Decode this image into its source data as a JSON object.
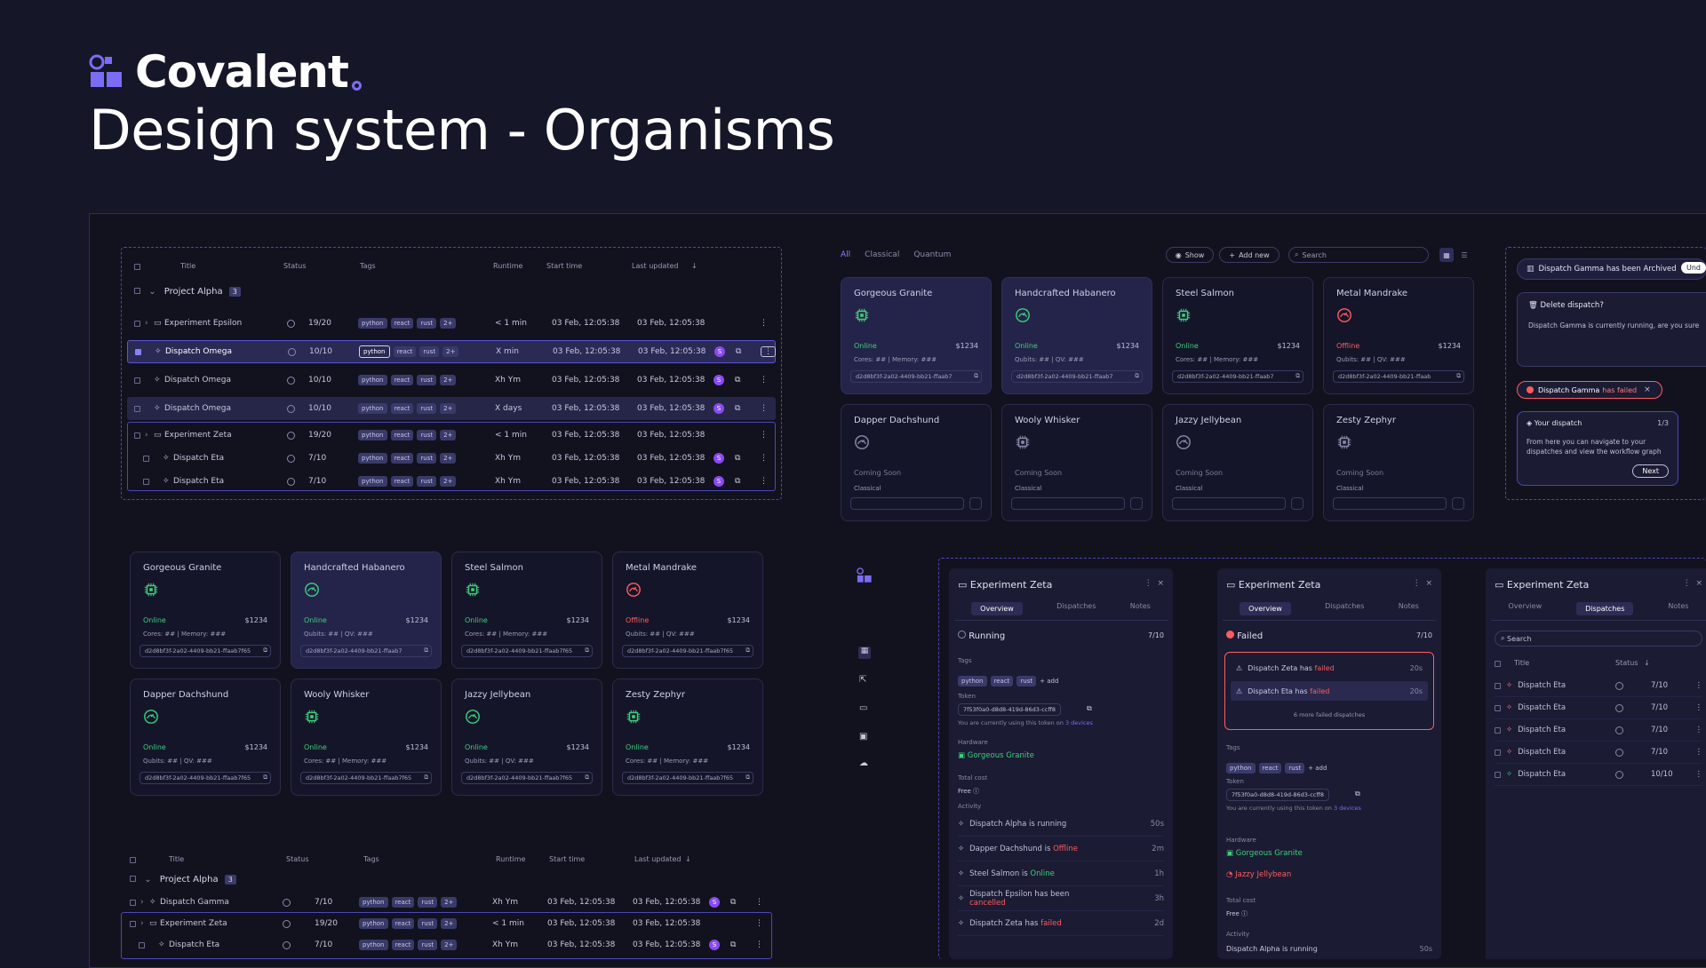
{
  "brand": "Covalent",
  "page_title": "Design system - Organisms",
  "table": {
    "headers": {
      "title": "Title",
      "status": "Status",
      "tags": "Tags",
      "runtime": "Runtime",
      "start": "Start time",
      "updated": "Last updated"
    },
    "group": {
      "name": "Project Alpha",
      "count": "3"
    },
    "rows": [
      {
        "name": "Experiment Epsilon",
        "status": "19/20",
        "runtime": "< 1 min",
        "start": "03 Feb, 12:05:38",
        "updated": "03 Feb, 12:05:38"
      },
      {
        "name": "Dispatch Omega",
        "status": "10/10",
        "runtime": "X min",
        "start": "03 Feb, 12:05:38",
        "updated": "03 Feb, 12:05:38"
      },
      {
        "name": "Dispatch Omega",
        "status": "10/10",
        "runtime": "Xh Ym",
        "start": "03 Feb, 12:05:38",
        "updated": "03 Feb, 12:05:38"
      },
      {
        "name": "Dispatch Omega",
        "status": "10/10",
        "runtime": "X days",
        "start": "03 Feb, 12:05:38",
        "updated": "03 Feb, 12:05:38"
      },
      {
        "name": "Experiment Zeta",
        "status": "19/20",
        "runtime": "< 1 min",
        "start": "03 Feb, 12:05:38",
        "updated": "03 Feb, 12:05:38"
      },
      {
        "name": "Dispatch Eta",
        "status": "7/10",
        "runtime": "Xh Ym",
        "start": "03 Feb, 12:05:38",
        "updated": "03 Feb, 12:05:38"
      },
      {
        "name": "Dispatch Eta",
        "status": "7/10",
        "runtime": "Xh Ym",
        "start": "03 Feb, 12:05:38",
        "updated": "03 Feb, 12:05:38"
      }
    ],
    "tags": [
      "python",
      "react",
      "rust",
      "2+"
    ],
    "avatar": "S"
  },
  "table2": {
    "rows": [
      {
        "name": "Dispatch Gamma",
        "status": "7/10",
        "runtime": "Xh Ym",
        "start": "03 Feb, 12:05:38",
        "updated": "03 Feb, 12:05:38"
      },
      {
        "name": "Experiment Zeta",
        "status": "19/20",
        "runtime": "< 1 min",
        "start": "03 Feb, 12:05:38",
        "updated": "03 Feb, 12:05:38"
      },
      {
        "name": "Dispatch Eta",
        "status": "7/10",
        "runtime": "Xh Ym",
        "start": "03 Feb, 12:05:38",
        "updated": "03 Feb, 12:05:38"
      }
    ]
  },
  "filters": {
    "all": "All",
    "classical": "Classical",
    "quantum": "Quantum",
    "show": "Show",
    "add_new": "Add new",
    "search": "Search"
  },
  "cards_top": [
    {
      "name": "Gorgeous Granite",
      "status": "Online",
      "price": "$1234",
      "meta": "Cores: ##  |  Memory: ###",
      "token": "d2d8bf3f-2a02-4409-bb21-ffaab7"
    },
    {
      "name": "Handcrafted Habanero",
      "status": "Online",
      "price": "$1234",
      "meta": "Qubits: ##  |  QV: ###",
      "token": "d2d8bf3f-2a02-4409-bb21-ffaab7"
    },
    {
      "name": "Steel Salmon",
      "status": "Online",
      "price": "$1234",
      "meta": "Cores: ##  |  Memory: ###",
      "token": "d2d8bf3f-2a02-4409-bb21-ffaab7"
    },
    {
      "name": "Metal Mandrake",
      "status": "Offline",
      "price": "$1234",
      "meta": "Qubits: ##  |  QV: ###",
      "token": "d2d8bf3f-2a02-4409-bb21-ffaab"
    },
    {
      "name": "Dapper Dachshund",
      "status": "Coming Soon",
      "sub": "Classical"
    },
    {
      "name": "Wooly Whisker",
      "status": "Coming Soon",
      "sub": "Classical"
    },
    {
      "name": "Jazzy Jellybean",
      "status": "Coming Soon",
      "sub": "Classical"
    },
    {
      "name": "Zesty Zephyr",
      "status": "Coming Soon",
      "sub": "Classical"
    }
  ],
  "cards_bottom": [
    {
      "name": "Gorgeous Granite",
      "status": "Online",
      "price": "$1234",
      "meta": "Cores: ##  |  Memory: ###",
      "token": "d2d8bf3f-2a02-4409-bb21-ffaab7f65"
    },
    {
      "name": "Handcrafted Habanero",
      "status": "Online",
      "price": "$1234",
      "meta": "Qubits: ##  |  QV: ###",
      "token": "d2d8bf3f-2a02-4409-bb21-ffaab7"
    },
    {
      "name": "Steel Salmon",
      "status": "Online",
      "price": "$1234",
      "meta": "Cores: ##  |  Memory: ###",
      "token": "d2d8bf3f-2a02-4409-bb21-ffaab7f65"
    },
    {
      "name": "Metal Mandrake",
      "status": "Offline",
      "price": "$1234",
      "meta": "Qubits: ##  |  QV: ###",
      "token": "d2d8bf3f-2a02-4409-bb21-ffaab7f65"
    },
    {
      "name": "Dapper Dachshund",
      "status": "Online",
      "price": "$1234",
      "meta": "Qubits: ##  |  QV: ###",
      "token": "d2d8bf3f-2a02-4409-bb21-ffaab7f65"
    },
    {
      "name": "Wooly Whisker",
      "status": "Online",
      "price": "$1234",
      "meta": "Cores: ##  |  Memory: ###",
      "token": "d2d8bf3f-2a02-4409-bb21-ffaab7f65"
    },
    {
      "name": "Jazzy Jellybean",
      "status": "Online",
      "price": "$1234",
      "meta": "Qubits: ##  |  QV: ###",
      "token": "d2d8bf3f-2a02-4409-bb21-ffaab7f65"
    },
    {
      "name": "Zesty Zephyr",
      "status": "Online",
      "price": "$1234",
      "meta": "Cores: ##  |  Memory: ###",
      "token": "d2d8bf3f-2a02-4409-bb21-ffaab7f65"
    }
  ],
  "notifications": {
    "archived": "Dispatch Gamma has been Archived",
    "undo": "Und",
    "delete_title": "Delete dispatch?",
    "delete_body": "Dispatch Gamma is currently running, are you sure",
    "failed_name": "Dispatch Gamma",
    "failed_word": "has failed",
    "tour_title": "Your dispatch",
    "tour_step": "1/3",
    "tour_body": "From here you can navigate to your dispatches and view the workflow graph",
    "tour_next": "Next"
  },
  "panel1": {
    "title": "Experiment Zeta",
    "tabs": [
      "Overview",
      "Dispatches",
      "Notes"
    ],
    "status": "Running",
    "count": "7/10",
    "tags_label": "Tags",
    "tags": [
      "python",
      "react",
      "rust",
      "+ add"
    ],
    "token_label": "Token",
    "token": "7f53f0a0-d8d8-419d-86d3-ccff8",
    "token_note": "You are currently using this token on",
    "token_devices": "3 devices",
    "hw_label": "Hardware",
    "hw": "Gorgeous Granite",
    "cost_label": "Total cost",
    "cost": "Free",
    "activity_label": "Activity",
    "activity": [
      {
        "a": "Dispatch Alpha is running",
        "t": "50s"
      },
      {
        "a": "Dapper Dachshund is",
        "b": "Offline",
        "t": "2m"
      },
      {
        "a": "Steel Salmon is",
        "b": "Online",
        "t": "1h"
      },
      {
        "a": "Dispatch Epsilon has been",
        "b": "cancelled",
        "t": "3h"
      },
      {
        "a": "Dispatch Zeta has",
        "b": "failed",
        "t": "2d"
      }
    ]
  },
  "panel2": {
    "title": "Experiment Zeta",
    "tabs": [
      "Overview",
      "Dispatches",
      "Notes"
    ],
    "status": "Failed",
    "count": "7/10",
    "fails": [
      {
        "a": "Dispatch Zeta has",
        "b": "failed",
        "t": "20s"
      },
      {
        "a": "Dispatch Eta has",
        "b": "failed",
        "t": "20s"
      }
    ],
    "more": "6 more failed dispatches",
    "tags_label": "Tags",
    "tags": [
      "python",
      "react",
      "rust",
      "+ add"
    ],
    "token_label": "Token",
    "token": "7f53f0a0-d8d8-419d-86d3-ccff8",
    "token_note": "You are currently using this token on",
    "token_devices": "3 devices",
    "hw_label": "Hardware",
    "hw": [
      "Gorgeous Granite",
      "Jazzy Jellybean"
    ],
    "cost_label": "Total cost",
    "cost": "Free",
    "activity_label": "Activity",
    "act0": "Dispatch Alpha is running",
    "act0t": "50s"
  },
  "panel3": {
    "title": "Experiment Zeta",
    "tabs": [
      "Overview",
      "Dispatches",
      "Notes"
    ],
    "search": "Search",
    "h_title": "Title",
    "h_status": "Status",
    "rows": [
      {
        "n": "Dispatch Eta",
        "s": "7/10"
      },
      {
        "n": "Dispatch Eta",
        "s": "7/10"
      },
      {
        "n": "Dispatch Eta",
        "s": "7/10"
      },
      {
        "n": "Dispatch Eta",
        "s": "7/10"
      },
      {
        "n": "Dispatch Eta",
        "s": "10/10"
      }
    ]
  },
  "colors": {
    "bg": "#161629",
    "accent": "#7b6cf5",
    "online": "#3ecf7a",
    "offline": "#ff5d5d"
  }
}
